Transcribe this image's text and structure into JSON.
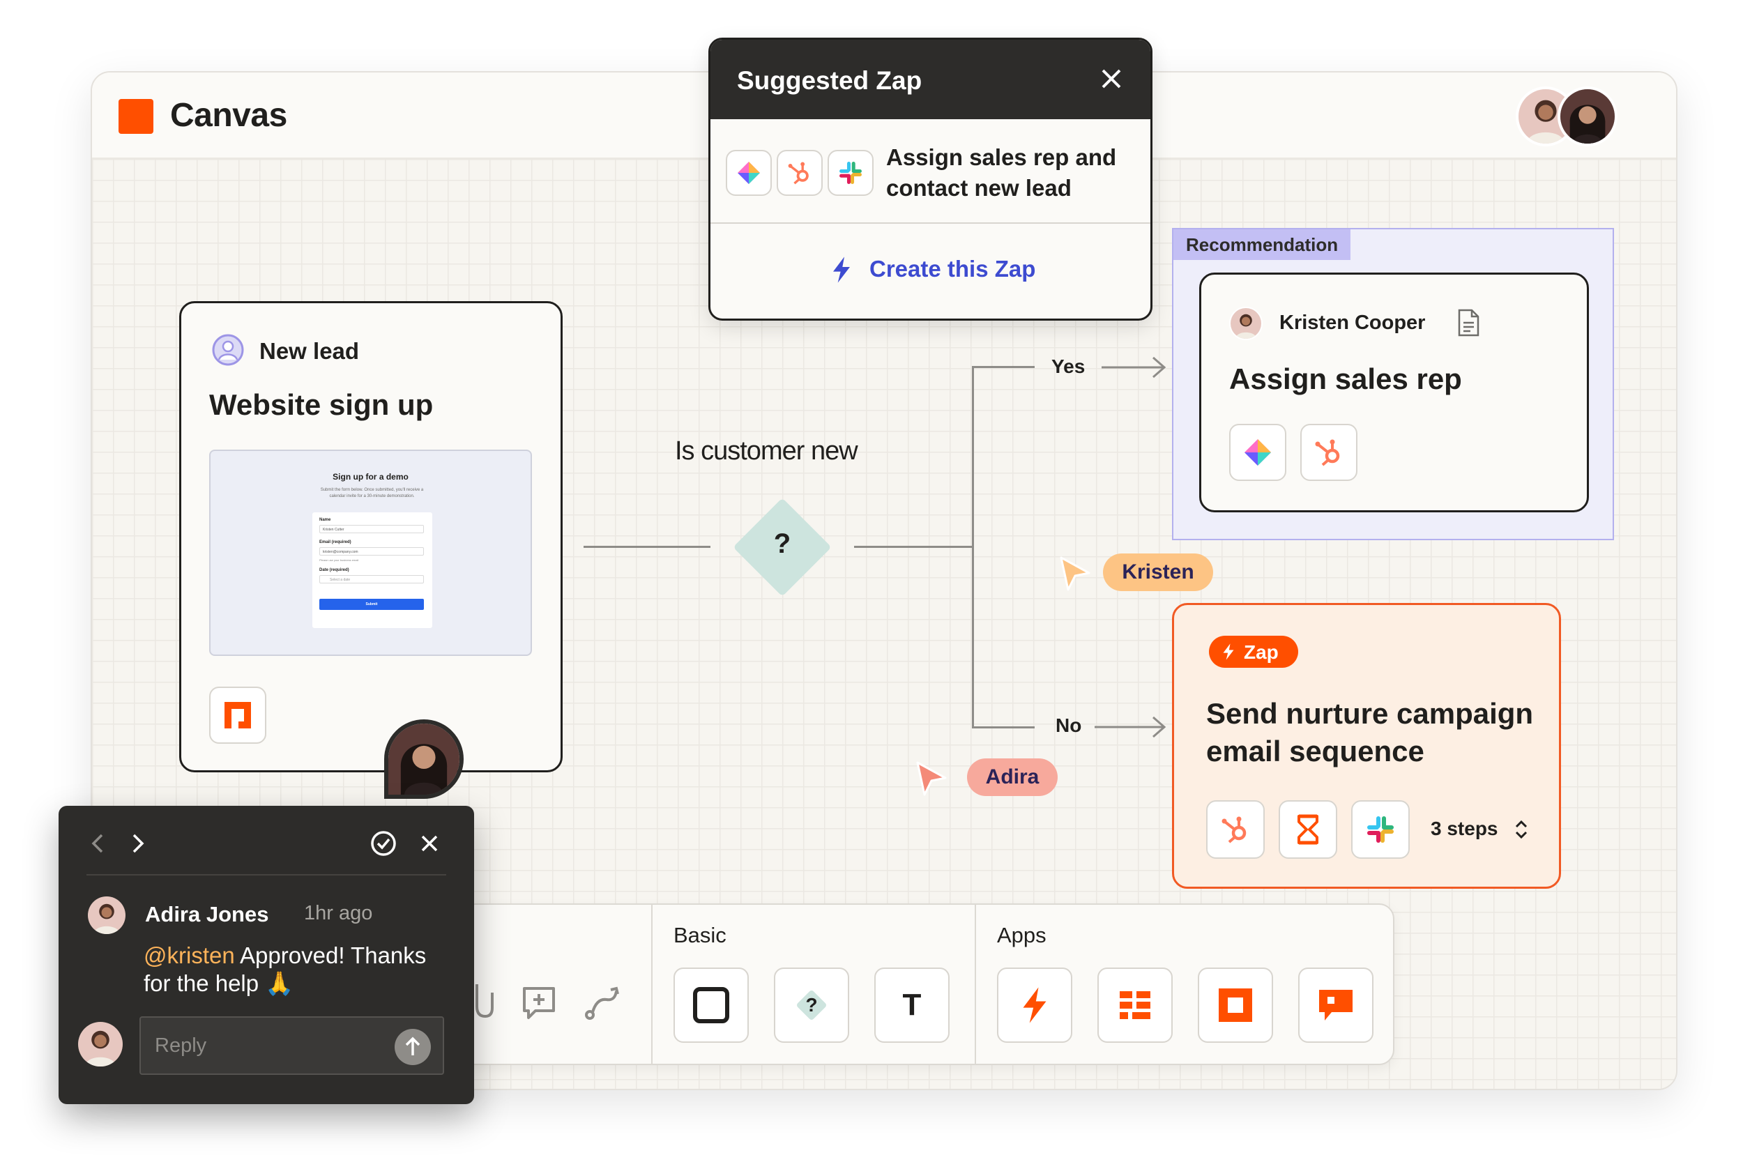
{
  "app": {
    "title": "Canvas"
  },
  "suggested_zap": {
    "title": "Suggested Zap",
    "description_line1": "Assign sales rep and",
    "description_line2": "contact new lead",
    "cta": "Create this Zap"
  },
  "trigger_card": {
    "tag": "New lead",
    "title": "Website sign up",
    "form_preview": {
      "heading": "Sign up for a demo",
      "subtext": "Submit the form below. Once submitted, you'll receive a calendar invite for a 30-minute demonstration.",
      "name_label": "Name",
      "name_value": "Kristen Cutter",
      "email_label": "Email (required)",
      "email_value": "kristen@company.com",
      "email_hint": "Please use your business email",
      "date_label": "Date (required)",
      "date_placeholder": "Select a date",
      "submit_label": "Submit"
    }
  },
  "decision": {
    "label": "Is customer new",
    "symbol": "?",
    "yes_label": "Yes",
    "no_label": "No"
  },
  "recommendation": {
    "badge": "Recommendation",
    "author": "Kristen Cooper",
    "title": "Assign sales rep"
  },
  "zap_card": {
    "badge": "Zap",
    "title_line1": "Send nurture campaign",
    "title_line2": "email sequence",
    "steps": "3 steps"
  },
  "cursors": [
    {
      "name": "Kristen"
    },
    {
      "name": "Adira"
    }
  ],
  "toolbar": {
    "basic_label": "Basic",
    "apps_label": "Apps",
    "text_tool": "T",
    "decision_tool": "?"
  },
  "comment": {
    "author": "Adira Jones",
    "time": "1hr ago",
    "mention": "@kristen",
    "text_line1": " Approved! Thanks",
    "text_line2": "for the help 🙏",
    "reply_placeholder": "Reply"
  },
  "colors": {
    "brand_orange": "#ff4f00",
    "accent_purple": "#3d4bd0",
    "recommendation_bg": "#eeeefa",
    "zap_card_bg": "#fdefe3",
    "kristen_cursor": "#fdc484",
    "adira_cursor": "#f7a99c"
  },
  "icons": [
    "close-icon",
    "bolt-icon",
    "hubspot-icon",
    "slack-icon",
    "diamond-logo-icon",
    "document-icon",
    "hourglass-icon",
    "user-icon",
    "chevron-left-icon",
    "chevron-right-icon",
    "check-circle-icon",
    "send-arrow-icon"
  ]
}
